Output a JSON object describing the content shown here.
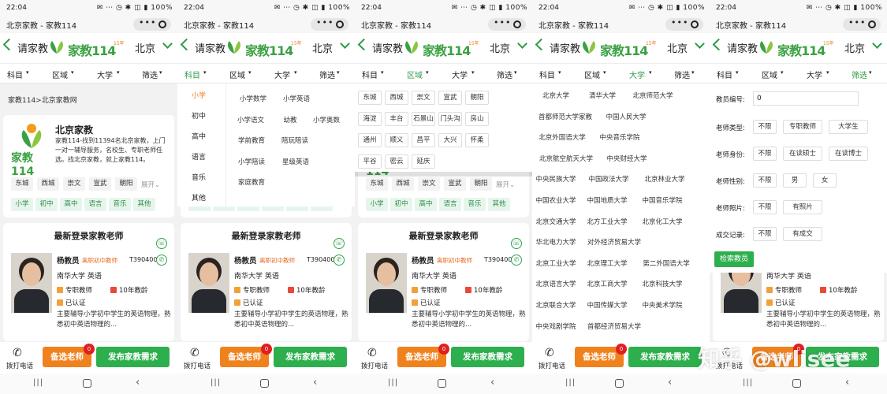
{
  "status": {
    "time": "22:04",
    "icons": "✉ ⋯ ◷ ✱ ◫ ▮ 100%"
  },
  "window": {
    "title": "北京家教 - 家教114",
    "menu_dots": "•••"
  },
  "header": {
    "back_label": "请家教",
    "logo_text": "家教114",
    "logo_badge": "15年",
    "city": "北京"
  },
  "filters": [
    "科目",
    "区域",
    "大学",
    "筛选"
  ],
  "breadcrumb": "家教114>北京家教网",
  "intro_card": {
    "logo_text": "家教114",
    "title": "北京家教",
    "desc": "家教114-找到11394名北京家教，上门一对一辅导服务，名校生、专职老师任选。找北京家教，就上家教114。",
    "districts": [
      "东城",
      "西城",
      "崇文",
      "宣武",
      "朝阳"
    ],
    "expand": "展开",
    "grades": [
      "小学",
      "初中",
      "高中",
      "语言",
      "音乐",
      "其他"
    ]
  },
  "teacher": {
    "section_title": "最新登录家教老师",
    "name": "杨教员",
    "level": "离职初中教师",
    "id": "T390400",
    "univ_subject": "南华大学  英语",
    "type": "专职教师",
    "years": "10年教龄",
    "verified": "已认证",
    "intro": "主要辅导小学初中学生的英语物理，熟悉初中英语物理的..."
  },
  "bottom": {
    "call": "拨打电话",
    "pick": "备选老师",
    "pick_count": "0",
    "publish": "发布家教需求"
  },
  "subject_menu": {
    "levels": [
      "小学",
      "初中",
      "高中",
      "语言",
      "音乐",
      "其他"
    ],
    "items": [
      "小学数学",
      "小学英语",
      "小学语文",
      "幼教",
      "小学奥数",
      "学前教育",
      "陪玩陪读",
      "小学陪读",
      "星级英语",
      "家庭教育"
    ]
  },
  "district_menu": [
    "东城",
    "西城",
    "崇文",
    "宣武",
    "朝阳",
    "海淀",
    "丰台",
    "石景山",
    "门头沟",
    "房山",
    "通州",
    "顺义",
    "昌平",
    "大兴",
    "怀柔",
    "平谷",
    "密云",
    "延庆"
  ],
  "university_menu": [
    "北京大学",
    "清华大学",
    "北京师范大学",
    "首都师范大学家教",
    "中国人民大学",
    "北京外国语大学",
    "中央音乐学院",
    "北京航空航天大学",
    "中央财经大学",
    "中央民族大学",
    "中国政法大学",
    "北京林业大学",
    "中国农业大学",
    "中国地质大学",
    "中国音乐学院",
    "北京交通大学",
    "北方工业大学",
    "北京化工大学",
    "华北电力大学",
    "对外经济贸易大学",
    "北京工业大学",
    "北京理工大学",
    "第二外国语大学",
    "北京语言大学",
    "北京工商大学",
    "北京科技大学",
    "北京联合大学",
    "中国传媒大学",
    "中央美术学院",
    "中央戏剧学院",
    "首都经济贸易大学"
  ],
  "screen_menu": {
    "id_label": "教员编号:",
    "id_value": "0",
    "rows": [
      {
        "label": "老师类型:",
        "opts": [
          "不限",
          "专职教师",
          "大学生"
        ]
      },
      {
        "label": "老师身份:",
        "opts": [
          "不限",
          "在读硕士",
          "在读博士"
        ]
      },
      {
        "label": "老师性别:",
        "opts": [
          "不限",
          "男",
          "女"
        ]
      },
      {
        "label": "老师照片:",
        "opts": [
          "不限",
          "有照片"
        ]
      },
      {
        "label": "成交记录:",
        "opts": [
          "不限",
          "有成交"
        ]
      }
    ],
    "search": "检索教员"
  },
  "watermark": "知乎 @wlisee",
  "colors": {
    "brand_green": "#2eaf4e",
    "orange": "#f0821e"
  }
}
